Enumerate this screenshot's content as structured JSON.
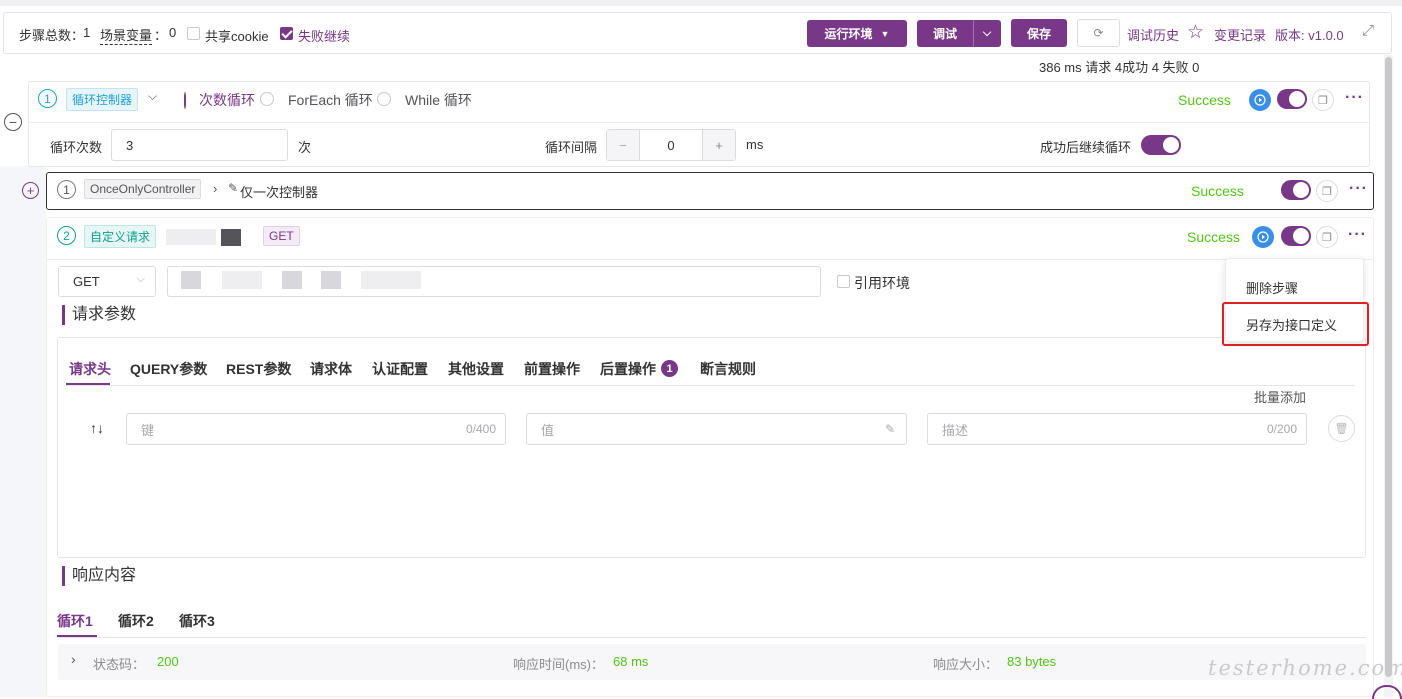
{
  "toolbar": {
    "step_total_label": "步骤总数：",
    "step_total_value": "1",
    "scene_var_label": "场景变量",
    "scene_var_sep": "：",
    "scene_var_value": "0",
    "share_cookie": "共享cookie",
    "fail_continue": "失败继续",
    "env_button": "运行环境",
    "debug_button": "调试",
    "save_button": "保存",
    "debug_history": "调试历史",
    "change_log": "变更记录",
    "version": "版本: v1.0.0",
    "run_summary": "386 ms 请求 4成功 4 失败 0"
  },
  "loop_step": {
    "index": "1",
    "type_tag": "循环控制器",
    "radios": [
      "次数循环",
      "ForEach 循环",
      "While 循环"
    ],
    "selected_radio": "次数循环",
    "status": "Success",
    "count_label": "循环次数",
    "count_value": "3",
    "count_unit": "次",
    "interval_label": "循环间隔",
    "interval_value": "0",
    "interval_unit": "ms",
    "continue_label": "成功后继续循环"
  },
  "once_step": {
    "index": "1",
    "type_tag": "OnceOnlyController",
    "name": "仅一次控制器",
    "status": "Success"
  },
  "request_step": {
    "index": "2",
    "type_tag": "自定义请求",
    "method_tag": "GET",
    "status": "Success",
    "method_select": "GET",
    "use_env_label": "引用环境",
    "context_menu": [
      "删除步骤",
      "另存为接口定义"
    ],
    "params_title": "请求参数",
    "tabs": [
      "请求头",
      "QUERY参数",
      "REST参数",
      "请求体",
      "认证配置",
      "其他设置",
      "前置操作",
      "后置操作",
      "断言规则"
    ],
    "post_op_badge": "1",
    "batch_add": "批量添加",
    "key_placeholder": "键",
    "key_count": "0/400",
    "value_placeholder": "值",
    "desc_placeholder": "描述",
    "desc_count": "0/200",
    "response_title": "响应内容",
    "loop_tabs": [
      "循环1",
      "循环2",
      "循环3"
    ],
    "status_code_label": "状态码：",
    "status_code_value": "200",
    "resp_time_label": "响应时间(ms)：",
    "resp_time_value": "68 ms",
    "resp_size_label": "响应大小：",
    "resp_size_value": "83 bytes"
  },
  "watermark": "testerhome.com",
  "colors": {
    "accent": "#783887",
    "success": "#52c41a",
    "info": "#1e9fd9"
  }
}
